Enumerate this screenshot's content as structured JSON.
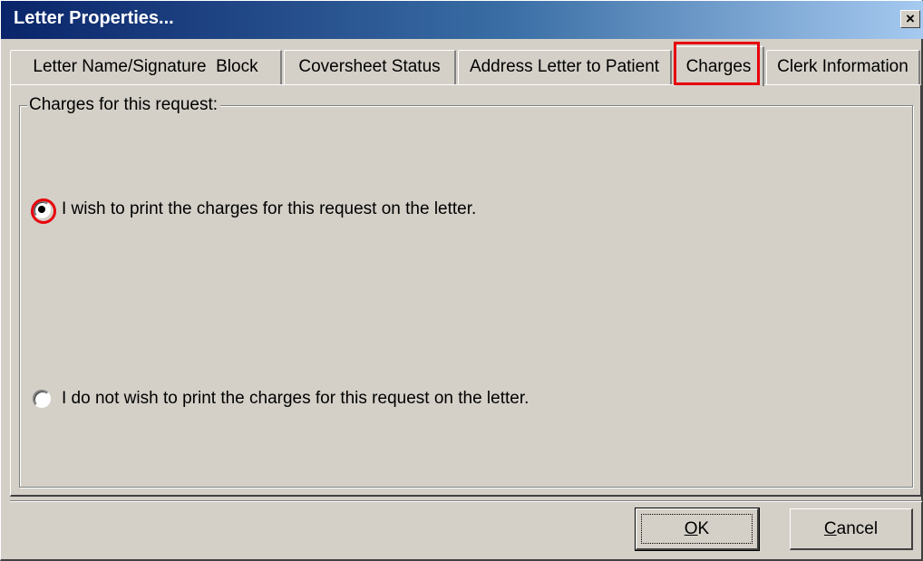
{
  "dialog": {
    "title": "Letter Properties...",
    "close_glyph": "×"
  },
  "tabs": [
    {
      "label": "Letter Name/Signature  Block",
      "active": false
    },
    {
      "label": "Coversheet Status",
      "active": false
    },
    {
      "label": "Address Letter to Patient",
      "active": false
    },
    {
      "label": "Charges",
      "active": true
    },
    {
      "label": "Clerk Information",
      "active": false
    }
  ],
  "charges": {
    "group_label": "Charges for this request:",
    "options": [
      {
        "label": "I wish to print the charges for this request on the letter.",
        "selected": true
      },
      {
        "label": "I do not wish to print the charges for this request on the letter.",
        "selected": false
      }
    ]
  },
  "buttons": {
    "ok": {
      "mnemonic": "O",
      "rest": "K"
    },
    "cancel": {
      "mnemonic": "C",
      "rest": "ancel"
    }
  },
  "colors": {
    "highlight": "#e8000b",
    "dialog_bg": "#d4d0c8",
    "title_start": "#0a246a",
    "title_end": "#a6caf0"
  }
}
